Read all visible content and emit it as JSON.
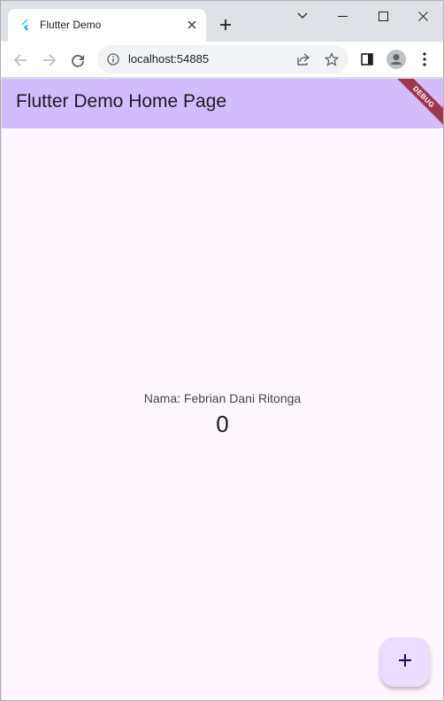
{
  "browser": {
    "tab_title": "Flutter Demo",
    "url": "localhost:54885"
  },
  "app": {
    "appbar_title": "Flutter Demo Home Page",
    "debug_banner": "DEBUG",
    "name_label": "Nama: Febrian Dani Ritonga",
    "counter_value": "0",
    "fab_icon": "plus-icon"
  },
  "colors": {
    "appbar": "#d1bcfe",
    "background": "#fef7ff",
    "fab": "#eaddff",
    "debug_banner": "#8c0000"
  }
}
